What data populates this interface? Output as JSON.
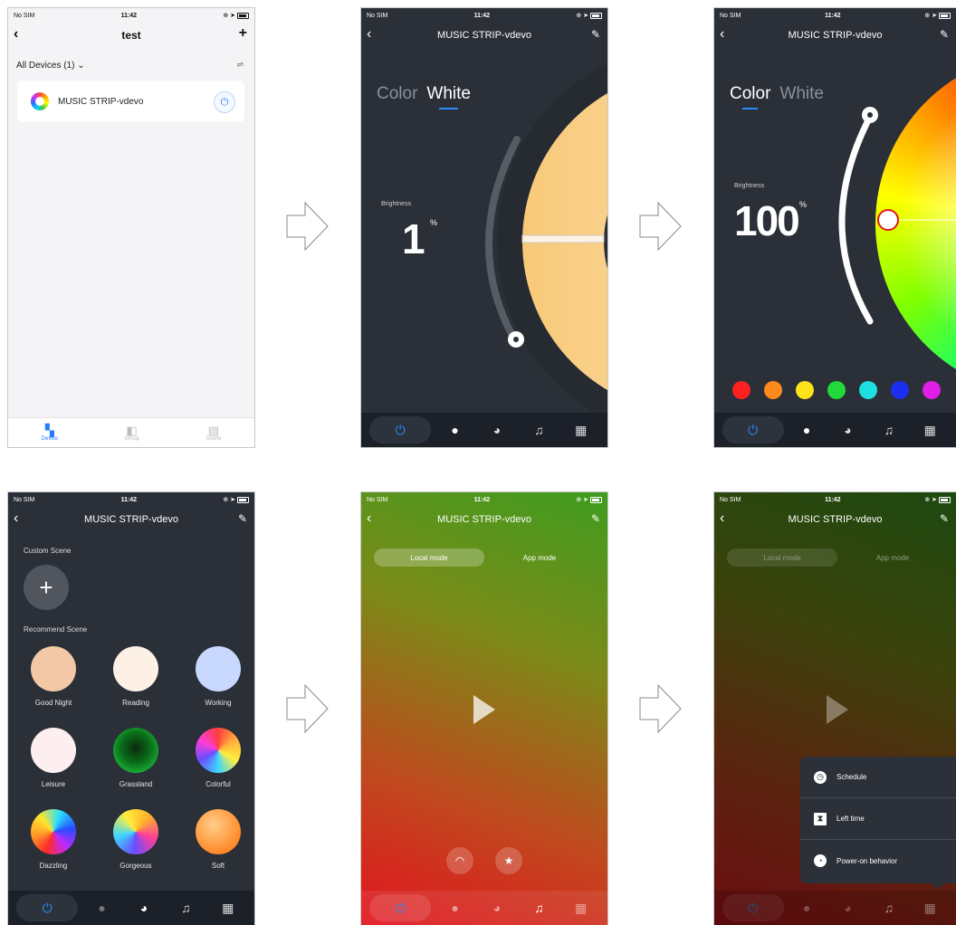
{
  "status": {
    "carrier": "No SIM",
    "time": "11:42"
  },
  "screen1": {
    "title": "test",
    "back_icon": "chevron-left-icon",
    "add_icon": "plus-icon",
    "all_devices": "All Devices (1)",
    "device_name": "MUSIC STRIP-vdevo",
    "tabs": [
      {
        "label": "Device",
        "icon": "grid-icon"
      },
      {
        "label": "Group",
        "icon": "group-icon"
      },
      {
        "label": "Scene",
        "icon": "scene-icon"
      }
    ]
  },
  "device_title": "MUSIC STRIP-vdevo",
  "white_screen": {
    "tab_color": "Color",
    "tab_white": "White",
    "brightness_label": "Brightness",
    "brightness_value": "1",
    "percent": "%"
  },
  "color_screen": {
    "tab_color": "Color",
    "tab_white": "White",
    "brightness_label": "Brightness",
    "brightness_value": "100",
    "percent": "%",
    "swatches": [
      "#ff2020",
      "#ff8a1c",
      "#ffe31a",
      "#22d93a",
      "#1ee0e0",
      "#1a2ff0",
      "#e01ee6"
    ]
  },
  "scene_screen": {
    "custom_label": "Custom Scene",
    "recommend_label": "Recommend Scene",
    "scenes": [
      {
        "name": "Good Night"
      },
      {
        "name": "Reading"
      },
      {
        "name": "Working"
      },
      {
        "name": "Leisure"
      },
      {
        "name": "Grassland"
      },
      {
        "name": "Colorful"
      },
      {
        "name": "Dazzling"
      },
      {
        "name": "Gorgeous"
      },
      {
        "name": "Soft"
      }
    ]
  },
  "music_screen": {
    "local_mode": "Local mode",
    "app_mode": "App mode"
  },
  "menu": {
    "items": [
      {
        "label": "Schedule",
        "icon": "clock-icon"
      },
      {
        "label": "Left time",
        "icon": "hourglass-icon"
      },
      {
        "label": "Power-on behavior",
        "icon": "power-behavior-icon"
      }
    ]
  },
  "colors": {
    "accent": "#2a8cff",
    "dark_bg": "#2a2f38",
    "tabbar": "#1c2028"
  }
}
